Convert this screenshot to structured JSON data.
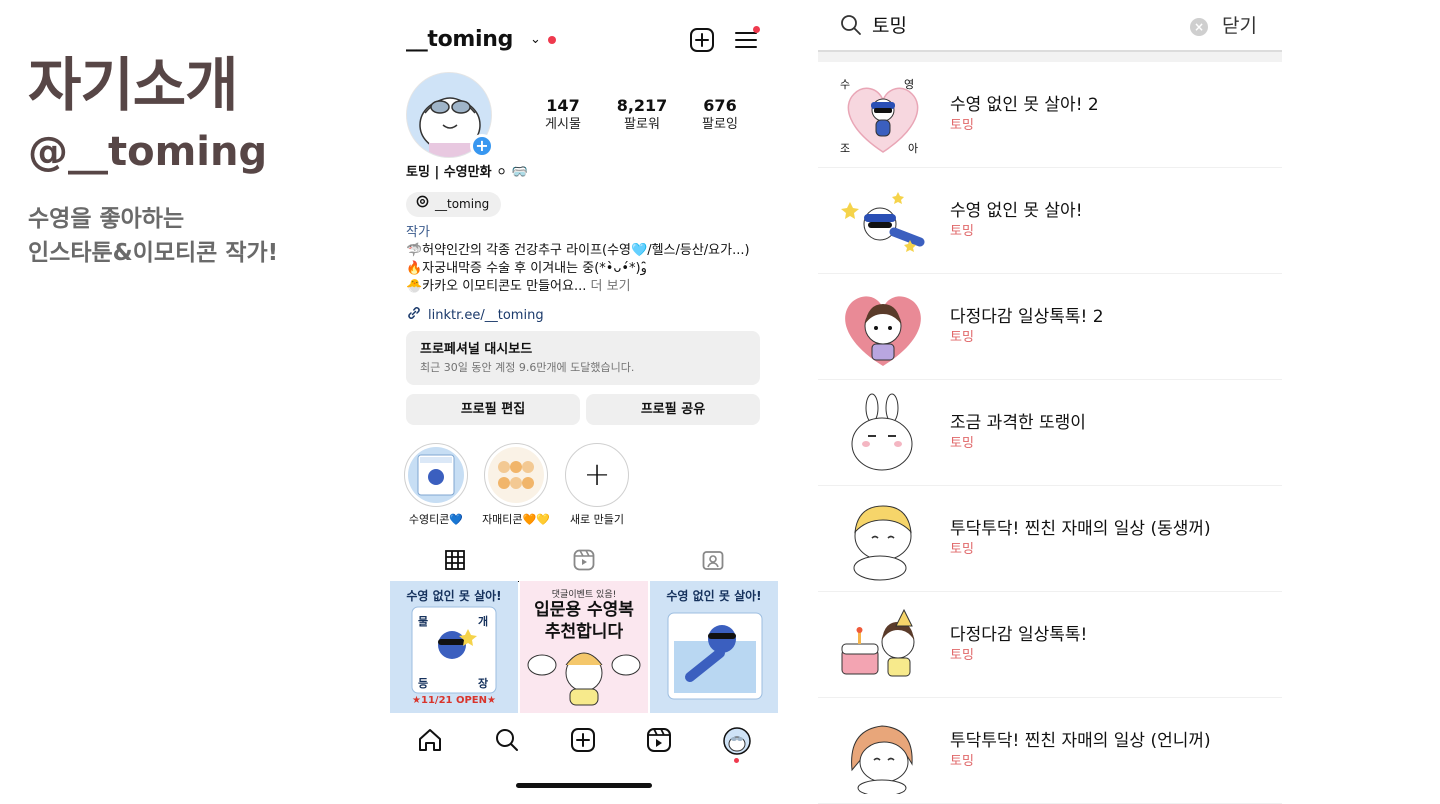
{
  "intro": {
    "title": "자기소개",
    "handle": "@__toming",
    "description": "수영을 좋아하는\n인스타툰&이모티콘 작가!"
  },
  "instagram": {
    "username": "__toming",
    "stats": [
      {
        "value": "147",
        "label": "게시물"
      },
      {
        "value": "8,217",
        "label": "팔로워"
      },
      {
        "value": "676",
        "label": "팔로잉"
      }
    ],
    "name": "토밍 | 수영만화 ⚪ 🥽",
    "threads_handle": "__toming",
    "category": "작가",
    "bio": [
      "🦈허약인간의 각종 건강추구 라이프(수영🩵/헬스/등산/요가...)",
      "🔥자궁내막증 수술 후 이겨내는 중(*•̀ᴗ•́*)و ̑̑",
      "🐣카카오 이모티콘도 만들어요..."
    ],
    "bio_more": "더 보기",
    "link": "linktr.ee/__toming",
    "dashboard": {
      "title": "프로페셔널 대시보드",
      "subtitle": "최근 30일 동안 계정 9.6만개에 도달했습니다."
    },
    "buttons": {
      "edit": "프로필 편집",
      "share": "프로필 공유"
    },
    "highlights": [
      {
        "label": "수영티콘💙"
      },
      {
        "label": "자매티콘🧡💛"
      },
      {
        "label": "새로 만들기"
      }
    ],
    "posts": [
      {
        "title": "수영 없인 못 살아!",
        "badge": "★11/21 OPEN★",
        "side_left": "물",
        "side_right": "개",
        "bottom_left": "등",
        "bottom_right": "장"
      },
      {
        "subtitle": "댓글이벤트 있음!",
        "title_line1": "입문용 수영복",
        "title_line2": "추천합니다"
      },
      {
        "title": "수영 없인 못 살아!"
      }
    ]
  },
  "search": {
    "query": "토밍",
    "close_label": "닫기",
    "results": [
      {
        "title": "수영 없인 못 살아! 2",
        "author": "토밍",
        "thumb_text": [
          "수",
          "영",
          "조",
          "아"
        ]
      },
      {
        "title": "수영 없인 못 살아!",
        "author": "토밍"
      },
      {
        "title": "다정다감 일상톡톡! 2",
        "author": "토밍"
      },
      {
        "title": "조금 과격한 또랭이",
        "author": "토밍"
      },
      {
        "title": "투닥투닥! 찐친 자매의 일상 (동생꺼)",
        "author": "토밍"
      },
      {
        "title": "다정다감 일상톡톡!",
        "author": "토밍"
      },
      {
        "title": "투닥투닥! 찐친 자매의 일상 (언니꺼)",
        "author": "토밍"
      }
    ]
  },
  "colors": {
    "intro_title": "#574646",
    "intro_desc": "#6a6a6a",
    "notification_dot": "#ef3a4e",
    "link": "#1b3a6b",
    "author": "#e0686a",
    "brand_blue": "#3897f0"
  }
}
